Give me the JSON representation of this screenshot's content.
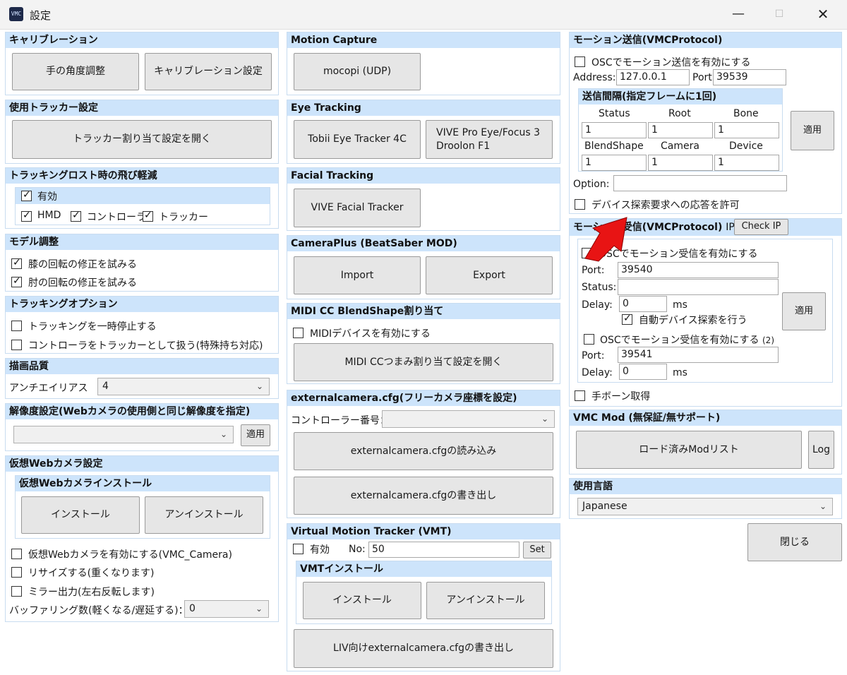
{
  "window": {
    "title": "設定",
    "icon_text": "VMC"
  },
  "calibration": {
    "header": "キャリブレーション",
    "hand_angle_button": "手の角度調整",
    "calibration_settings_button": "キャリブレーション設定"
  },
  "tracker_settings": {
    "header": "使用トラッカー設定",
    "open_button": "トラッカー割り当て設定を開く"
  },
  "lost_tracking": {
    "header": "トラッキングロスト時の飛び軽減",
    "enabled_label": "有効",
    "enabled": true,
    "hmd_label": "HMD",
    "hmd": true,
    "controller_label": "コントローラ",
    "controller": true,
    "tracker_label": "トラッカー",
    "tracker": true
  },
  "model_adjust": {
    "header": "モデル調整",
    "knee_label": "膝の回転の修正を試みる",
    "knee": true,
    "elbow_label": "肘の回転の修正を試みる",
    "elbow": true
  },
  "tracking_options": {
    "header": "トラッキングオプション",
    "pause_label": "トラッキングを一時停止する",
    "pause": false,
    "controller_as_tracker_label": "コントローラをトラッカーとして扱う(特殊持ち対応)",
    "controller_as_tracker": false
  },
  "render_quality": {
    "header": "描画品質",
    "aa_label": "アンチエイリアス　x",
    "aa_value": "4"
  },
  "resolution": {
    "header": "解像度設定(Webカメラの使用側と同じ解像度を指定)",
    "value": "",
    "apply_button": "適用"
  },
  "virtual_webcam": {
    "header": "仮想Webカメラ設定",
    "install_header": "仮想Webカメラインストール",
    "install_button": "インストール",
    "uninstall_button": "アンインストール",
    "enable_label": "仮想Webカメラを有効にする(VMC_Camera)",
    "enable": false,
    "resize_label": "リサイズする(重くなります)",
    "resize": false,
    "mirror_label": "ミラー出力(左右反転します)",
    "mirror": false,
    "buffer_label": "バッファリング数(軽くなる/遅延する)：",
    "buffer_value": "0"
  },
  "motion_capture": {
    "header": "Motion Capture",
    "mocopi_button": "mocopi (UDP)"
  },
  "eye_tracking": {
    "header": "Eye Tracking",
    "tobii_button": "Tobii Eye Tracker 4C",
    "vive_button_line1": "VIVE Pro Eye/Focus 3",
    "vive_button_line2": "Droolon F1"
  },
  "facial_tracking": {
    "header": "Facial Tracking",
    "vive_facial_button": "VIVE Facial Tracker"
  },
  "cameraplus": {
    "header": "CameraPlus (BeatSaber MOD)",
    "import_button": "Import",
    "export_button": "Export"
  },
  "midi": {
    "header": "MIDI CC BlendShape割り当て",
    "enable_label": "MIDIデバイスを有効にする",
    "enable": false,
    "open_button": "MIDI CCつまみ割り当て設定を開く"
  },
  "external_camera": {
    "header": "externalcamera.cfg(フリーカメラ座標を設定)",
    "controller_no_label": "コントローラー番号：",
    "controller_no_value": "",
    "load_button": "externalcamera.cfgの読み込み",
    "write_button": "externalcamera.cfgの書き出し"
  },
  "vmt": {
    "header": "Virtual Motion Tracker (VMT)",
    "enabled_label": "有効",
    "enabled": false,
    "no_label": "No:",
    "no_value": "50",
    "set_button": "Set",
    "install_header": "VMTインストール",
    "install_button": "インストール",
    "uninstall_button": "アンインストール",
    "liv_button": "LIV向けexternalcamera.cfgの書き出し"
  },
  "motion_send": {
    "header": "モーション送信(VMCProtocol)",
    "enable_label": "OSCでモーション送信を有効にする",
    "enable": false,
    "address_label": "Address:",
    "address_value": "127.0.0.1",
    "port_label": "Port:",
    "port_value": "39539",
    "interval_header": "送信間隔(指定フレームに1回)",
    "status_label": "Status",
    "status_value": "1",
    "root_label": "Root",
    "root_value": "1",
    "bone_label": "Bone",
    "bone_value": "1",
    "blendshape_label": "BlendShape",
    "blendshape_value": "1",
    "camera_label": "Camera",
    "camera_value": "1",
    "device_label": "Device",
    "device_value": "1",
    "apply_button": "適用",
    "option_label": "Option:",
    "option_value": "",
    "discovery_label": "デバイス探索要求への応答を許可",
    "discovery": false
  },
  "motion_receive": {
    "header": "モーション受信(VMCProtocol)",
    "ip_label": "IP:",
    "check_ip_button": "Check IP",
    "enable1_label": "OSCでモーション受信を有効にする",
    "enable1": false,
    "port_label": "Port:",
    "port1_value": "39540",
    "status_label": "Status:",
    "status_value": "",
    "delay_label": "Delay:",
    "delay1_value": "0",
    "ms_label": "ms",
    "auto_discovery_label": "自動デバイス探索を行う",
    "auto_discovery": true,
    "apply_button": "適用",
    "enable2_label": "OSCでモーション受信を有効にする",
    "enable2_suffix": "(2)",
    "enable2": false,
    "port2_value": "39541",
    "delay2_value": "0",
    "hand_bone_label": "手ボーン取得",
    "hand_bone": false
  },
  "vmc_mod": {
    "header": "VMC Mod (無保証/無サポート)",
    "loaded_mods_button": "ロード済みModリスト",
    "log_button": "Log"
  },
  "language": {
    "header": "使用言語",
    "value": "Japanese"
  },
  "close_button": "閉じる",
  "colors": {
    "header_bg": "#cde4fb",
    "panel_border": "#c8dcf0",
    "button_bg": "#e6e6e6",
    "arrow": "#e81414"
  }
}
